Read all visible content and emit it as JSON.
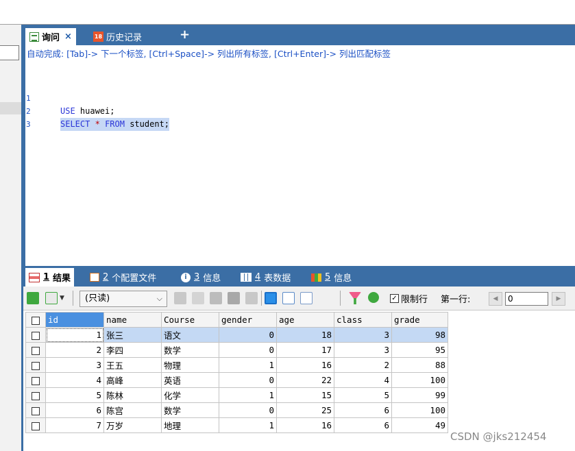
{
  "editor": {
    "tabs": [
      {
        "label": "询问",
        "close": "×"
      },
      {
        "label": "历史记录"
      }
    ],
    "calendar_icon_text": "18",
    "add_tab": "+",
    "hint": "自动完成: [Tab]-> 下一个标签, [Ctrl+Space]-> 列出所有标签, [Ctrl+Enter]-> 列出匹配标签",
    "lines": [
      {
        "n": "1",
        "kw": "USE",
        "rest": " huawei;"
      },
      {
        "n": "2",
        "kw1": "SELECT",
        "star": "*",
        "kw2": "FROM",
        "rest": " student;"
      },
      {
        "n": "3"
      }
    ]
  },
  "result_tabs": [
    {
      "num": "1",
      "label": "结果"
    },
    {
      "num": "2",
      "label": "个配置文件"
    },
    {
      "num": "3",
      "label": "信息"
    },
    {
      "num": "4",
      "label": "表数据"
    },
    {
      "num": "5",
      "label": "信息"
    }
  ],
  "toolbar": {
    "mode": "(只读)",
    "limit_label": "限制行",
    "limit_checked": true,
    "first_row_label": "第一行:",
    "first_row_value": "0"
  },
  "table": {
    "columns": [
      "id",
      "name",
      "Course",
      "gender",
      "age",
      "class",
      "grade"
    ],
    "rows": [
      [
        "1",
        "张三",
        "语文",
        "0",
        "18",
        "3",
        "98"
      ],
      [
        "2",
        "李四",
        "数学",
        "0",
        "17",
        "3",
        "95"
      ],
      [
        "3",
        "王五",
        "物理",
        "1",
        "16",
        "2",
        "88"
      ],
      [
        "4",
        "高峰",
        "英语",
        "0",
        "22",
        "4",
        "100"
      ],
      [
        "5",
        "陈林",
        "化学",
        "1",
        "15",
        "5",
        "99"
      ],
      [
        "6",
        "陈宫",
        "数学",
        "0",
        "25",
        "6",
        "100"
      ],
      [
        "7",
        "万岁",
        "地理",
        "1",
        "16",
        "6",
        "49"
      ]
    ]
  },
  "watermark": "CSDN @jks212454",
  "colors": {
    "panel_blue": "#3b6ea5",
    "header_blue": "#4a90e0",
    "selected_row": "#c4d9f4",
    "hint_text": "#1a4fc4"
  }
}
